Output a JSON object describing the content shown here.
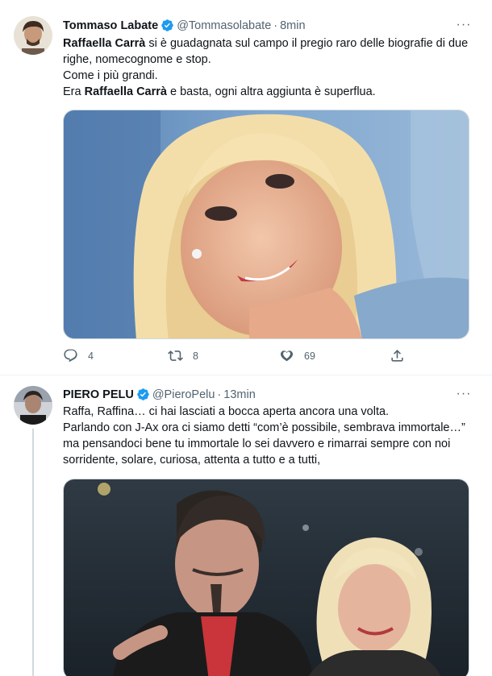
{
  "tweets": [
    {
      "author": {
        "name": "Tommaso Labate",
        "handle": "@Tommasolabate",
        "verified": true
      },
      "time": "8min",
      "text": [
        [
          {
            "b": "Raffaella Carrà"
          },
          {
            "t": " si è guadagnata sul campo il pregio raro delle biografie di due righe, nomecognome e stop."
          }
        ],
        [
          {
            "t": "Come i più grandi."
          }
        ],
        [
          {
            "t": "Era "
          },
          {
            "b": "Raffaella Carrà"
          },
          {
            "t": " e basta, ogni altra aggiunta è superflua."
          }
        ]
      ],
      "stats": {
        "replies": "4",
        "retweets": "8",
        "likes": "69"
      }
    },
    {
      "author": {
        "name": "PIERO PELU",
        "handle": "@PieroPelu",
        "verified": true
      },
      "time": "13min",
      "text": [
        [
          {
            "t": "Raffa, Raffina… ci hai lasciati a bocca aperta ancora una volta."
          }
        ],
        [
          {
            "t": "Parlando con J-Ax ora ci siamo detti “com’è possibile, sembrava immortale…” ma pensandoci bene tu immortale lo sei davvero e rimarrai sempre con noi sorridente, solare, curiosa, attenta a tutto e a tutti,"
          }
        ]
      ]
    }
  ],
  "ui": {
    "more_glyph": "···",
    "separator": "·"
  },
  "colors": {
    "text": "#0f1419",
    "secondary": "#536471",
    "verified": "#1d9bf0",
    "border": "#eff3f4"
  }
}
